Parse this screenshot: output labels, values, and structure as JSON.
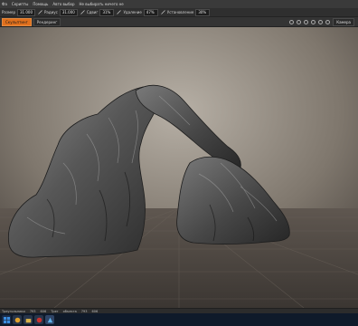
{
  "menubar": {
    "items": [
      "Фа",
      "Скрипты",
      "Помощь",
      "Авто выбор",
      "Не выбирать ничего не"
    ]
  },
  "toolbar": {
    "size_label": "Размер",
    "size_value": "31.000",
    "radius_label": "Радиус",
    "radius_value": "31.000",
    "jitter_label": "Сдвиг",
    "jitter_value": "31%",
    "removal_label": "Удаление",
    "removal_value": "47%",
    "fix_label": "Установление",
    "fix_value": "30%"
  },
  "tabs": [
    {
      "label": "Скульптинг",
      "active": true
    },
    {
      "label": "Рендеринг",
      "active": false
    }
  ],
  "viewport": {
    "camera_label": "Камера",
    "icons": [
      "rotate-icon",
      "pan-icon",
      "zoom-icon",
      "light-icon",
      "grid-icon",
      "settings-icon"
    ]
  },
  "statusbar": {
    "items": [
      "Треугольники",
      "793",
      "606",
      "Трег",
      "объекта",
      "793",
      "606"
    ]
  },
  "taskbar": {
    "icons": [
      "start-icon",
      "browser-icon",
      "folder-icon",
      "app-icon",
      "sculpt-app-icon"
    ]
  },
  "colors": {
    "accent": "#e0701d",
    "background": "#2a2a2a"
  }
}
